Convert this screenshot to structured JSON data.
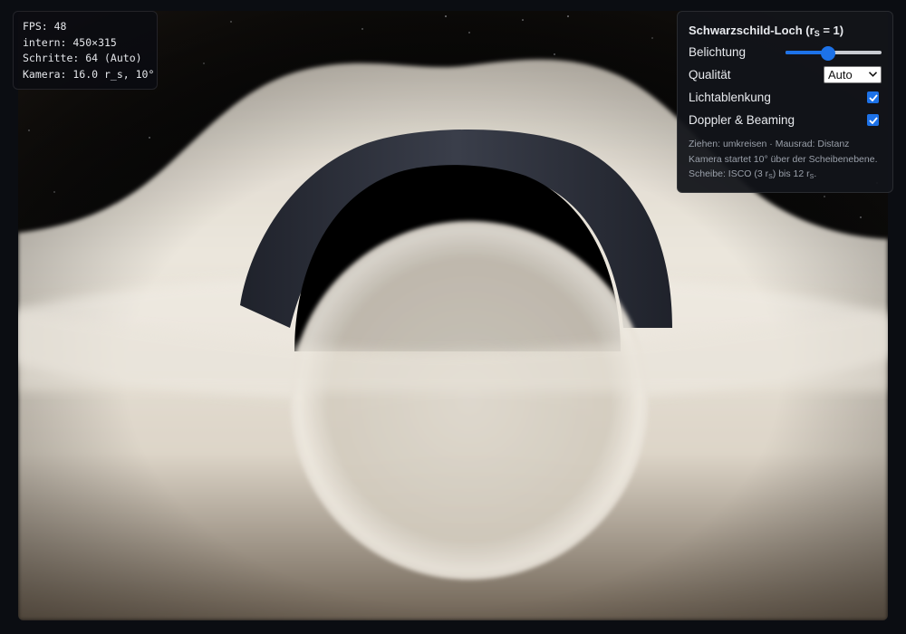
{
  "hud": {
    "fps": "FPS: 48",
    "intern": "intern: 450×315",
    "schritte": "Schritte: 64 (Auto)",
    "kamera": "Kamera: 16.0 r_s, 10°"
  },
  "panel": {
    "title_prefix": "Schwarzschild-Loch (r",
    "title_sub": "S",
    "title_suffix": " = 1)",
    "belichtung_label": "Belichtung",
    "belichtung_value": 0.43,
    "qualitaet_label": "Qualität",
    "qualitaet_value": "Auto",
    "lichtablenkung_label": "Lichtablenkung",
    "lichtablenkung_checked": true,
    "doppler_label": "Doppler & Beaming",
    "doppler_checked": true,
    "hint_line1": "Ziehen: umkreisen · Mausrad: Distanz",
    "hint_line2": "Kamera startet 10° über der Scheibenebene.",
    "hint_line3_a": "Scheibe: ISCO (3 r",
    "hint_line3_sub1": "S",
    "hint_line3_b": ") bis 12 r",
    "hint_line3_sub2": "S",
    "hint_line3_c": "."
  },
  "colors": {
    "accent": "#1d72e8",
    "disk": "#e4ddd0",
    "photon_ring": "#2f3340",
    "shadow": "#000000"
  }
}
